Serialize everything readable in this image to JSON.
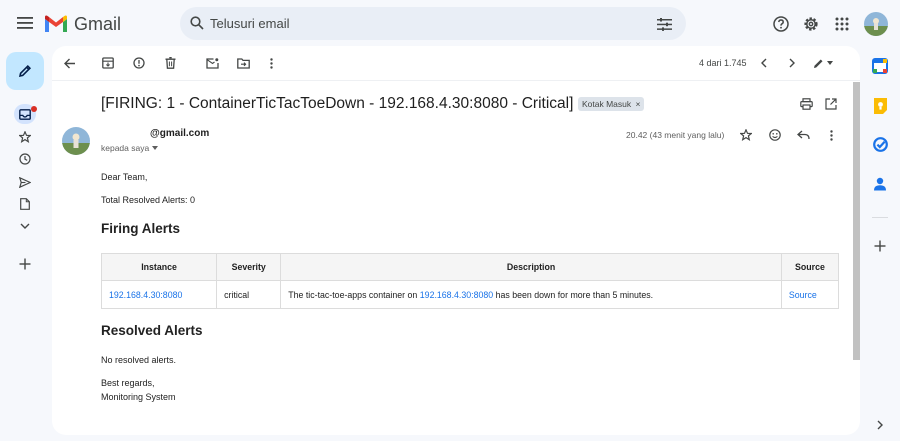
{
  "header": {
    "app_name": "Gmail",
    "search_placeholder": "Telusuri email"
  },
  "toolbar": {
    "counter": "4 dari 1.745"
  },
  "message": {
    "subject": "[FIRING: 1 - ContainerTicTacToeDown - 192.168.4.30:8080 - Critical]",
    "label": "Kotak Masuk",
    "label_close": "×",
    "sender": "@gmail.com",
    "recipient": "kepada saya",
    "time": "20.42 (43 menit yang lalu)"
  },
  "email": {
    "greeting": "Dear Team,",
    "total_resolved": "Total Resolved Alerts: 0",
    "firing_heading": "Firing Alerts",
    "table": {
      "headers": [
        "Instance",
        "Severity",
        "Description",
        "Source"
      ],
      "rows": [
        {
          "instance": "192.168.4.30:8080",
          "severity": "critical",
          "desc_before": "The tic-tac-toe-apps container on ",
          "desc_link": "192.168.4.30:8080",
          "desc_after": " has been down for more than 5 minutes.",
          "source": "Source"
        }
      ]
    },
    "resolved_heading": "Resolved Alerts",
    "no_resolved": "No resolved alerts.",
    "signoff": "Best regards,",
    "signature": "Monitoring System"
  },
  "colors": {
    "compose_bg": "#c2e7ff",
    "link": "#1a73e8",
    "background": "#f6f8fc",
    "unread_dot": "#d93025"
  },
  "icons": {
    "header": [
      "menu-icon",
      "gmail-logo-icon",
      "search-icon",
      "filter-options-icon",
      "help-icon",
      "settings-icon",
      "apps-grid-icon",
      "avatar"
    ],
    "left_rail": [
      "pencil-icon",
      "inbox-icon",
      "star-icon",
      "clock-icon",
      "send-icon",
      "draft-icon",
      "chevron-down-icon",
      "plus-icon"
    ],
    "toolbar": [
      "back-arrow-icon",
      "archive-icon",
      "report-spam-icon",
      "delete-icon",
      "mark-unread-icon",
      "move-to-icon",
      "more-vert-icon",
      "chevron-left-icon",
      "chevron-right-icon",
      "pen-icon"
    ],
    "message": [
      "print-icon",
      "open-new-window-icon",
      "star-icon",
      "emoji-icon",
      "reply-icon",
      "more-vert-icon"
    ],
    "right_rail": [
      "calendar-icon",
      "keep-icon",
      "tasks-icon",
      "contacts-icon",
      "plus-icon",
      "chevron-right-icon"
    ]
  }
}
